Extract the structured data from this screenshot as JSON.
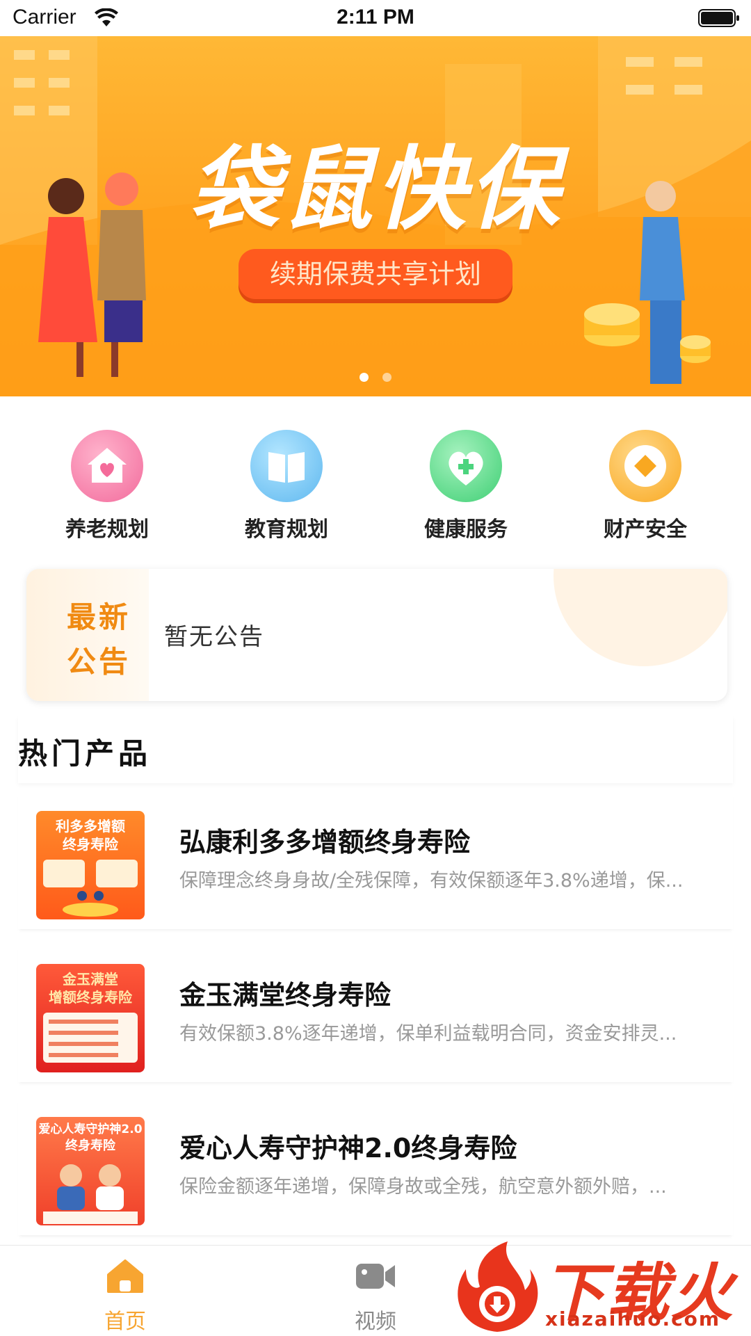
{
  "status_bar": {
    "carrier": "Carrier",
    "time": "2:11 PM"
  },
  "banner": {
    "title": "袋鼠快保",
    "subtitle": "续期保费共享计划",
    "page_count": 2,
    "active_page": 1
  },
  "categories": [
    {
      "label": "养老规划",
      "icon": "home-heart-icon",
      "color": "#f78fb3"
    },
    {
      "label": "教育规划",
      "icon": "book-icon",
      "color": "#7ecbf5"
    },
    {
      "label": "健康服务",
      "icon": "heart-plus-icon",
      "color": "#5fdc86"
    },
    {
      "label": "财产安全",
      "icon": "coin-icon",
      "color": "#fbb437"
    }
  ],
  "notice": {
    "tag_line1": "最新",
    "tag_line2": "公告",
    "text": "暂无公告"
  },
  "hot": {
    "title": "热门产品",
    "products": [
      {
        "name": "弘康利多多增额终身寿险",
        "desc": "保障理念终身身故/全残保障，有效保额逐年3.8%递增，保...",
        "thumb_line1": "利多多增额",
        "thumb_line2": "终身寿险",
        "thumb_color": "#ff7a1e"
      },
      {
        "name": "金玉满堂终身寿险",
        "desc": "有效保额3.8%逐年递增，保单利益载明合同，资金安排灵...",
        "thumb_line1": "金玉满堂",
        "thumb_line2": "增额终身寿险",
        "thumb_color": "#e8322a"
      },
      {
        "name": "爱心人寿守护神2.0终身寿险",
        "desc": "保险金额逐年递增，保障身故或全残，航空意外额外赔，...",
        "thumb_line1": "爱心人寿守护神2.0",
        "thumb_line2": "终身寿险",
        "thumb_color": "#f0502a"
      }
    ]
  },
  "tabbar": {
    "tabs": [
      {
        "label": "首页",
        "icon": "home-icon",
        "active": true
      },
      {
        "label": "视频",
        "icon": "video-camera-icon",
        "active": false
      }
    ],
    "active_color": "#f7a531",
    "inactive_color": "#8a8a8a"
  },
  "watermark": {
    "text": "下载火",
    "url": "xiazaihuo.com"
  }
}
